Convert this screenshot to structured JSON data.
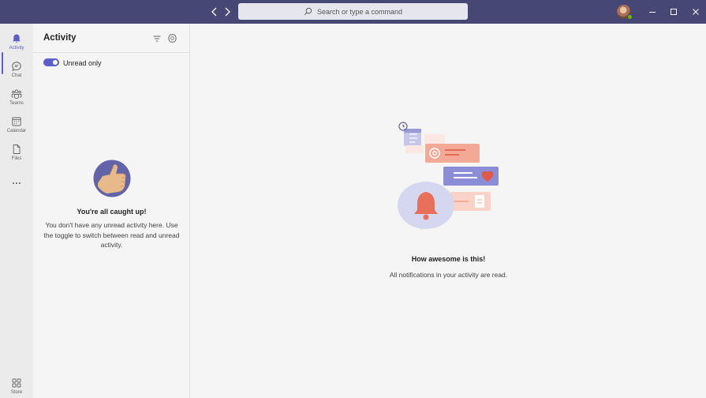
{
  "search": {
    "placeholder": "Search or type a command"
  },
  "rail": {
    "items": [
      {
        "label": "Activity",
        "icon": "bell-icon"
      },
      {
        "label": "Chat",
        "icon": "chat-icon"
      },
      {
        "label": "Teams",
        "icon": "teams-icon"
      },
      {
        "label": "Calendar",
        "icon": "calendar-icon"
      },
      {
        "label": "Files",
        "icon": "file-icon"
      },
      {
        "label": "",
        "icon": "more-icon"
      },
      {
        "label": "Store",
        "icon": "apps-icon"
      }
    ]
  },
  "activity": {
    "title": "Activity",
    "toggle_label": "Unread only",
    "toggle_on": true,
    "empty_title": "You're all caught up!",
    "empty_desc": "You don't have any unread activity here. Use the toggle to switch between read and unread activity."
  },
  "main": {
    "title": "How awesome is this!",
    "desc": "All notifications in your activity are read."
  },
  "colors": {
    "titlebar": "#464775",
    "accent": "#5b5fc7",
    "presence": "#6bb700"
  }
}
